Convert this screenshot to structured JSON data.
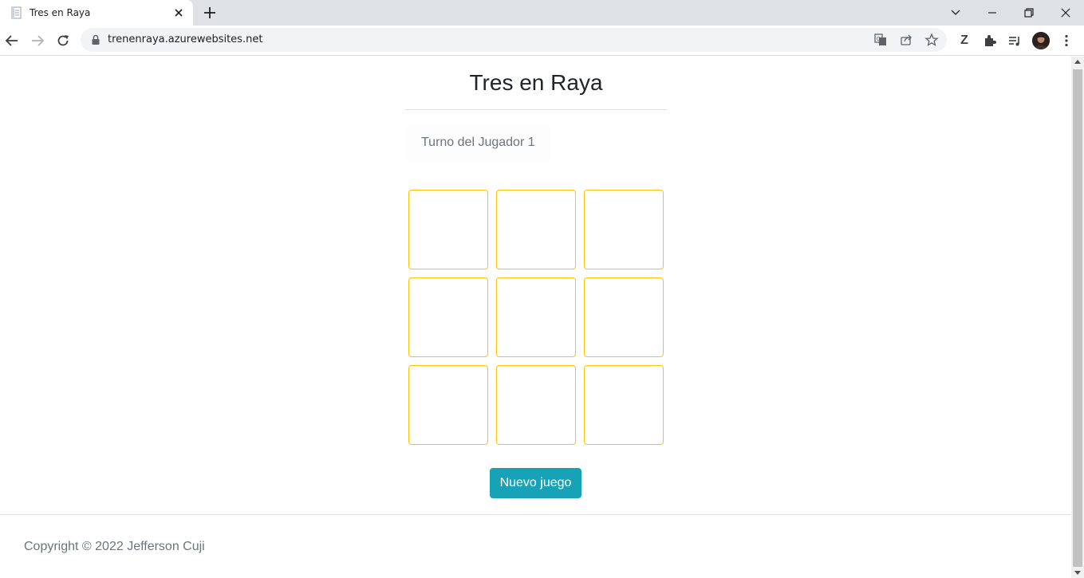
{
  "browser": {
    "tab_title": "Tres en Raya",
    "url": "trenenraya.azurewebsites.net",
    "extension_letter": "Z"
  },
  "icons": {
    "tab_favicon": "document-icon",
    "tab_close": "close-icon",
    "new_tab": "plus-icon",
    "back": "arrow-left-icon",
    "forward": "arrow-right-icon",
    "reload": "reload-icon",
    "lock": "lock-icon",
    "translate": "translate-icon",
    "share": "share-icon",
    "bookmark": "star-icon",
    "extensions": "puzzle-icon",
    "media": "media-queue-icon",
    "menu": "kebab-menu-icon"
  },
  "page": {
    "title": "Tres en Raya",
    "turn_status": "Turno del Jugador 1",
    "board": [
      "",
      "",
      "",
      "",
      "",
      "",
      "",
      "",
      ""
    ],
    "new_game_label": "Nuevo juego",
    "footer": "Copyright © 2022 Jefferson Cuji"
  },
  "colors": {
    "accent_button": "#17a2b8",
    "cell_border": "#ffc107",
    "muted_text": "#6c757d"
  }
}
